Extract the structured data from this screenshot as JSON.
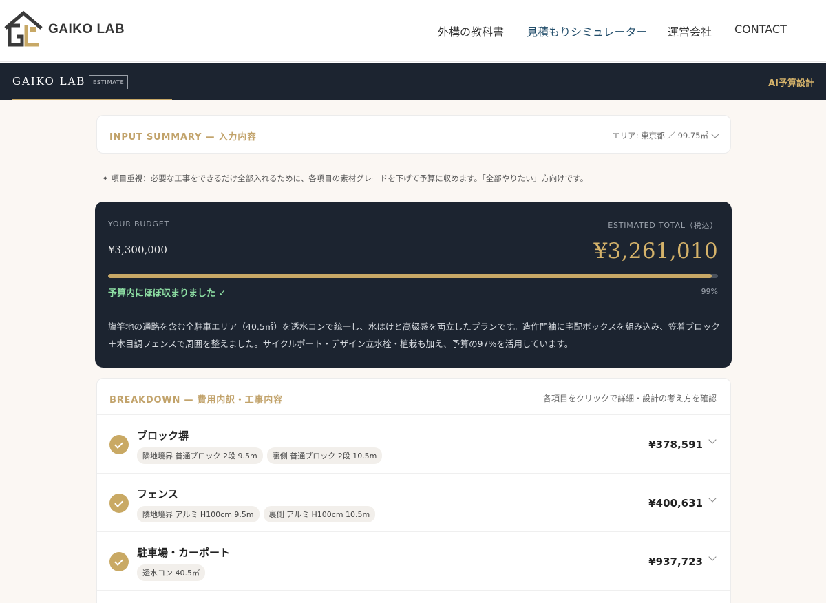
{
  "site": {
    "logo_text": "GAIKO LAB",
    "nav": [
      "外構の教科書",
      "見積もりシミュレーター",
      "運営会社",
      "CONTACT"
    ]
  },
  "app_bar": {
    "brand": "GAIKO LAB",
    "badge": "ESTIMATE",
    "right_label": "AI予算設計"
  },
  "summary": {
    "title": "INPUT SUMMARY — 入力内容",
    "area_info": "エリア: 東京都 ／ 99.75㎡"
  },
  "note": "✦ 項目重視：必要な工事をできるだけ全部入れるために、各項目の素材グレードを下げて予算に収めます。「全部やりたい」方向けです。",
  "budget": {
    "budget_label": "YOUR BUDGET",
    "budget_value": "¥3,300,000",
    "estimated_label": "ESTIMATED TOTAL（税込）",
    "estimated_value": "¥3,261,010",
    "progress_percent": 99,
    "status": "予算内にほぼ収まりました ✓",
    "percent_label": "99%",
    "description": "旗竿地の通路を含む全駐車エリア（40.5㎡）を透水コンで統一し、水はけと高級感を両立したプランです。造作門袖に宅配ボックスを組み込み、笠着ブロック＋木目調フェンスで周囲を整えました。サイクルポート・デザイン立水栓・植栽も加え、予算の97%を活用しています。"
  },
  "breakdown": {
    "title": "BREAKDOWN — 費用内訳・工事内容",
    "hint": "各項目をクリックで詳細・設計の考え方を確認",
    "items": [
      {
        "name": "ブロック塀",
        "tags": [
          "隣地境界 普通ブロック 2段 9.5m",
          "裏側 普通ブロック 2段 10.5m"
        ],
        "price": "¥378,591"
      },
      {
        "name": "フェンス",
        "tags": [
          "隣地境界 アルミ H100cm 9.5m",
          "裏側 アルミ H100cm 10.5m"
        ],
        "price": "¥400,631"
      },
      {
        "name": "駐車場・カーポート",
        "tags": [
          "透水コン 40.5㎡"
        ],
        "price": "¥937,723"
      }
    ]
  },
  "colors": {
    "dark_navy": "#1c2430",
    "gold": "#c7a866",
    "status_green": "#8ee0a4"
  }
}
